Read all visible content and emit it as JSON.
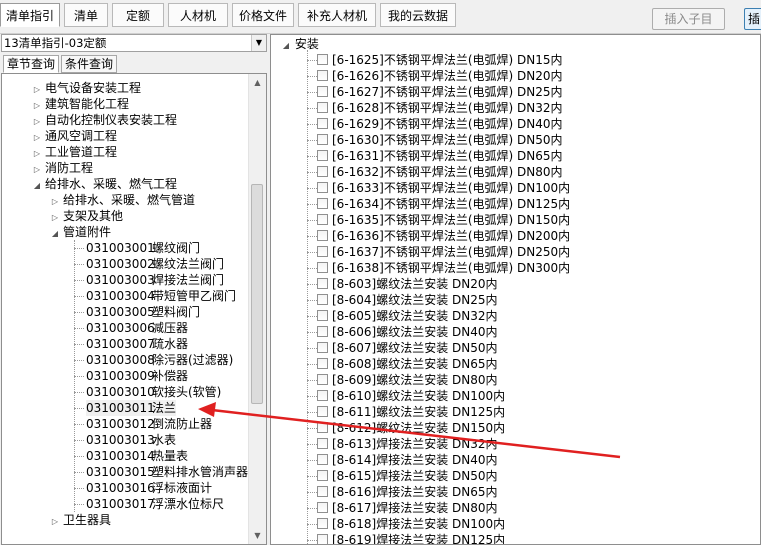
{
  "top_tabs": [
    {
      "label": "清单指引"
    },
    {
      "label": "清单"
    },
    {
      "label": "定额"
    },
    {
      "label": "人材机"
    },
    {
      "label": "价格文件"
    },
    {
      "label": "补充人材机"
    },
    {
      "label": "我的云数据"
    }
  ],
  "insert_child_label": "插入子目",
  "insert_label": "插",
  "guide_select": "13清单指引-03定额",
  "sub_tabs": [
    {
      "label": "章节查询"
    },
    {
      "label": "条件查询"
    }
  ],
  "tree_items": [
    {
      "label": "电气设备安装工程",
      "exp": "▷"
    },
    {
      "label": "建筑智能化工程",
      "exp": "▷"
    },
    {
      "label": "自动化控制仪表安装工程",
      "exp": "▷"
    },
    {
      "label": "通风空调工程",
      "exp": "▷"
    },
    {
      "label": "工业管道工程",
      "exp": "▷"
    },
    {
      "label": "消防工程",
      "exp": "▷"
    },
    {
      "label": "给排水、采暖、燃气工程",
      "exp": "◢"
    },
    {
      "label": "给排水、采暖、燃气管道",
      "exp": "▷"
    },
    {
      "label": "支架及其他",
      "exp": "▷"
    },
    {
      "label": "管道附件",
      "exp": "◢"
    }
  ],
  "leaf_items": [
    {
      "code": "031003001",
      "name": "螺纹阀门"
    },
    {
      "code": "031003002",
      "name": "螺纹法兰阀门"
    },
    {
      "code": "031003003",
      "name": "焊接法兰阀门"
    },
    {
      "code": "031003004",
      "name": "带短管甲乙阀门"
    },
    {
      "code": "031003005",
      "name": "塑料阀门"
    },
    {
      "code": "031003006",
      "name": "减压器"
    },
    {
      "code": "031003007",
      "name": "疏水器"
    },
    {
      "code": "031003008",
      "name": "除污器(过滤器)"
    },
    {
      "code": "031003009",
      "name": "补偿器"
    },
    {
      "code": "031003010",
      "name": "软接头(软管)"
    },
    {
      "code": "031003011",
      "name": "法兰"
    },
    {
      "code": "031003012",
      "name": "倒流防止器"
    },
    {
      "code": "031003013",
      "name": "水表"
    },
    {
      "code": "031003014",
      "name": "热量表"
    },
    {
      "code": "031003015",
      "name": "塑料排水管消声器"
    },
    {
      "code": "031003016",
      "name": "浮标液面计"
    },
    {
      "code": "031003017",
      "name": "浮漂水位标尺"
    }
  ],
  "tree_tail_label": "卫生器具",
  "right_root": "安装",
  "norm_items": [
    "[6-1625]不锈钢平焊法兰(电弧焊) DN15内",
    "[6-1626]不锈钢平焊法兰(电弧焊) DN20内",
    "[6-1627]不锈钢平焊法兰(电弧焊) DN25内",
    "[6-1628]不锈钢平焊法兰(电弧焊) DN32内",
    "[6-1629]不锈钢平焊法兰(电弧焊) DN40内",
    "[6-1630]不锈钢平焊法兰(电弧焊) DN50内",
    "[6-1631]不锈钢平焊法兰(电弧焊) DN65内",
    "[6-1632]不锈钢平焊法兰(电弧焊) DN80内",
    "[6-1633]不锈钢平焊法兰(电弧焊) DN100内",
    "[6-1634]不锈钢平焊法兰(电弧焊) DN125内",
    "[6-1635]不锈钢平焊法兰(电弧焊) DN150内",
    "[6-1636]不锈钢平焊法兰(电弧焊) DN200内",
    "[6-1637]不锈钢平焊法兰(电弧焊) DN250内",
    "[6-1638]不锈钢平焊法兰(电弧焊) DN300内",
    "[8-603]螺纹法兰安装 DN20内",
    "[8-604]螺纹法兰安装 DN25内",
    "[8-605]螺纹法兰安装 DN32内",
    "[8-606]螺纹法兰安装 DN40内",
    "[8-607]螺纹法兰安装 DN50内",
    "[8-608]螺纹法兰安装 DN65内",
    "[8-609]螺纹法兰安装 DN80内",
    "[8-610]螺纹法兰安装 DN100内",
    "[8-611]螺纹法兰安装 DN125内",
    "[8-612]螺纹法兰安装 DN150内",
    "[8-613]焊接法兰安装 DN32内",
    "[8-614]焊接法兰安装 DN40内",
    "[8-615]焊接法兰安装 DN50内",
    "[8-616]焊接法兰安装 DN65内",
    "[8-617]焊接法兰安装 DN80内",
    "[8-618]焊接法兰安装 DN100内",
    "[8-619]焊接法兰安装 DN125内"
  ],
  "annotation_color": "#e02020"
}
